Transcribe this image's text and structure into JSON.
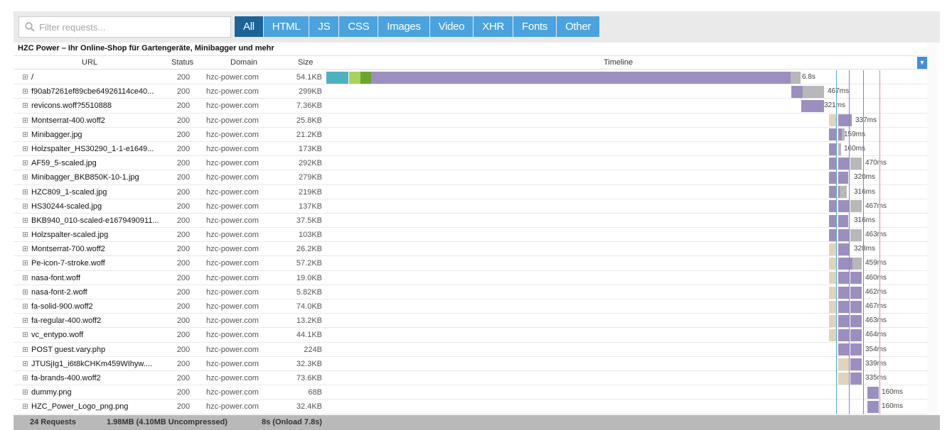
{
  "filter": {
    "placeholder": "Filter requests..."
  },
  "tabs": [
    "All",
    "HTML",
    "JS",
    "CSS",
    "Images",
    "Video",
    "XHR",
    "Fonts",
    "Other"
  ],
  "page_title": "HZC Power – Ihr Online-Shop für Gartengeräte, Minibagger und mehr",
  "columns": {
    "url": "URL",
    "status": "Status",
    "domain": "Domain",
    "size": "Size",
    "timeline": "Timeline"
  },
  "colors": {
    "dns": "#4fb0c0",
    "connect": "#a8d35a",
    "ssl": "#6aa52c",
    "wait": "#9c8fc0",
    "receive": "#b8b8b8",
    "blocked": "#e0d4bc"
  },
  "requests": [
    {
      "url": "/",
      "status": "200",
      "domain": "hzc-power.com",
      "size": "54.1KB",
      "time": "6.8s"
    },
    {
      "url": "f90ab7261ef89cbe64926114ce40...",
      "status": "200",
      "domain": "hzc-power.com",
      "size": "299KB",
      "time": "467ms"
    },
    {
      "url": "revicons.woff?5510888",
      "status": "200",
      "domain": "hzc-power.com",
      "size": "7.36KB",
      "time": "321ms"
    },
    {
      "url": "Montserrat-400.woff2",
      "status": "200",
      "domain": "hzc-power.com",
      "size": "25.8KB",
      "time": "337ms"
    },
    {
      "url": "Minibagger.jpg",
      "status": "200",
      "domain": "hzc-power.com",
      "size": "21.2KB",
      "time": "159ms"
    },
    {
      "url": "Holzspalter_HS30290_1-1-e1649...",
      "status": "200",
      "domain": "hzc-power.com",
      "size": "173KB",
      "time": "160ms"
    },
    {
      "url": "AF59_5-scaled.jpg",
      "status": "200",
      "domain": "hzc-power.com",
      "size": "292KB",
      "time": "470ms"
    },
    {
      "url": "Minibagger_BKB850K-10-1.jpg",
      "status": "200",
      "domain": "hzc-power.com",
      "size": "279KB",
      "time": "320ms"
    },
    {
      "url": "HZC809_1-scaled.jpg",
      "status": "200",
      "domain": "hzc-power.com",
      "size": "219KB",
      "time": "316ms"
    },
    {
      "url": "HS30244-scaled.jpg",
      "status": "200",
      "domain": "hzc-power.com",
      "size": "137KB",
      "time": "467ms"
    },
    {
      "url": "BKB940_010-scaled-e1679490911...",
      "status": "200",
      "domain": "hzc-power.com",
      "size": "37.5KB",
      "time": "316ms"
    },
    {
      "url": "Holzspalter-scaled.jpg",
      "status": "200",
      "domain": "hzc-power.com",
      "size": "103KB",
      "time": "463ms"
    },
    {
      "url": "Montserrat-700.woff2",
      "status": "200",
      "domain": "hzc-power.com",
      "size": "26.2KB",
      "time": "328ms"
    },
    {
      "url": "Pe-icon-7-stroke.woff",
      "status": "200",
      "domain": "hzc-power.com",
      "size": "57.2KB",
      "time": "459ms"
    },
    {
      "url": "nasa-font.woff",
      "status": "200",
      "domain": "hzc-power.com",
      "size": "19.0KB",
      "time": "460ms"
    },
    {
      "url": "nasa-font-2.woff",
      "status": "200",
      "domain": "hzc-power.com",
      "size": "5.82KB",
      "time": "462ms"
    },
    {
      "url": "fa-solid-900.woff2",
      "status": "200",
      "domain": "hzc-power.com",
      "size": "74.0KB",
      "time": "467ms"
    },
    {
      "url": "fa-regular-400.woff2",
      "status": "200",
      "domain": "hzc-power.com",
      "size": "13.2KB",
      "time": "463ms"
    },
    {
      "url": "vc_entypo.woff",
      "status": "200",
      "domain": "hzc-power.com",
      "size": "44.1KB",
      "time": "464ms"
    },
    {
      "url": "POST guest.vary.php",
      "status": "200",
      "domain": "hzc-power.com",
      "size": "224B",
      "time": "354ms"
    },
    {
      "url": "JTUSjIg1_i6t8kCHKm459WIhyw....",
      "status": "200",
      "domain": "hzc-power.com",
      "size": "32.3KB",
      "time": "339ms"
    },
    {
      "url": "fa-brands-400.woff2",
      "status": "200",
      "domain": "hzc-power.com",
      "size": "73.6KB",
      "time": "335ms"
    },
    {
      "url": "dummy.png",
      "status": "200",
      "domain": "hzc-power.com",
      "size": "68B",
      "time": "160ms"
    },
    {
      "url": "HZC_Power_Logo_png.png",
      "status": "200",
      "domain": "hzc-power.com",
      "size": "32.4KB",
      "time": "160ms"
    }
  ],
  "footer": {
    "requests": "24 Requests",
    "transfer": "1.98MB  (4.10MB Uncompressed)",
    "load": "8s  (Onload 7.8s)"
  }
}
